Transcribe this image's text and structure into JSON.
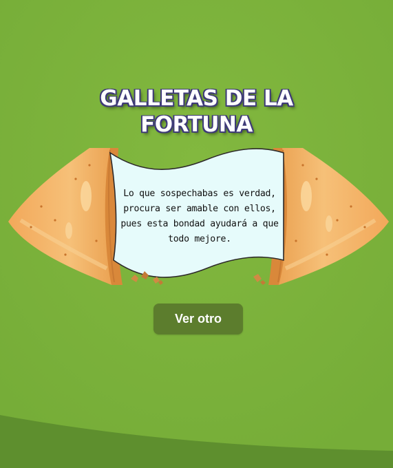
{
  "title": {
    "line1": "GALLETAS DE LA",
    "line2": "FORTUNA"
  },
  "fortune": {
    "message": "Lo que sospechabas es verdad, procura ser amable con ellos, pues esta bondad ayudará a que todo mejore."
  },
  "actions": {
    "next_label": "Ver otro"
  },
  "colors": {
    "background": "#7db33c",
    "bottom_wave": "#5e8f2e",
    "button": "#5c7d2d",
    "paper": "#e6fbfb",
    "cookie": "#f0a95a",
    "title_outline": "#3e3a78"
  },
  "icons": [
    "left-cookie-half",
    "right-cookie-half",
    "paper-slip",
    "cookie-crumbs"
  ]
}
